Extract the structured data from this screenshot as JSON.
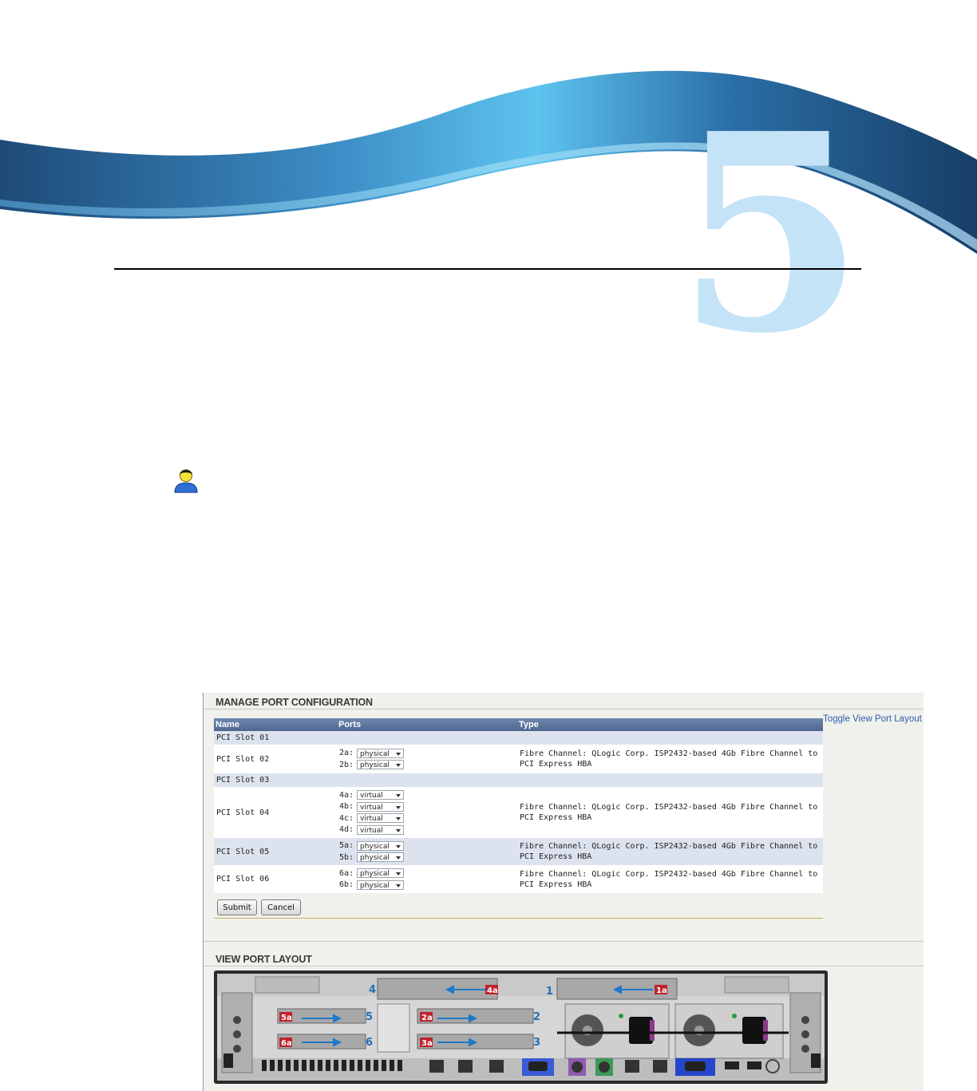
{
  "chapter_number": "5",
  "manage_section": {
    "title": "MANAGE PORT CONFIGURATION",
    "toggle_link": "Toggle View Port Layout",
    "columns": [
      "Name",
      "Ports",
      "Type"
    ],
    "rows": [
      {
        "name": "PCI Slot 01",
        "ports": [],
        "type": ""
      },
      {
        "name": "PCI Slot 02",
        "ports": [
          {
            "label": "2a:",
            "value": "physical"
          },
          {
            "label": "2b:",
            "value": "physical"
          }
        ],
        "type": "Fibre Channel: QLogic Corp. ISP2432-based 4Gb Fibre Channel to PCI Express HBA"
      },
      {
        "name": "PCI Slot 03",
        "ports": [],
        "type": ""
      },
      {
        "name": "PCI Slot 04",
        "ports": [
          {
            "label": "4a:",
            "value": "virtual"
          },
          {
            "label": "4b:",
            "value": "virtual"
          },
          {
            "label": "4c:",
            "value": "virtual"
          },
          {
            "label": "4d:",
            "value": "virtual"
          }
        ],
        "type": "Fibre Channel: QLogic Corp. ISP2432-based 4Gb Fibre Channel to PCI Express HBA"
      },
      {
        "name": "PCI Slot 05",
        "ports": [
          {
            "label": "5a:",
            "value": "physical"
          },
          {
            "label": "5b:",
            "value": "physical"
          }
        ],
        "type": "Fibre Channel: QLogic Corp. ISP2432-based 4Gb Fibre Channel to PCI Express HBA"
      },
      {
        "name": "PCI Slot 06",
        "ports": [
          {
            "label": "6a:",
            "value": "physical"
          },
          {
            "label": "6b:",
            "value": "physical"
          }
        ],
        "type": "Fibre Channel: QLogic Corp. ISP2432-based 4Gb Fibre Channel to PCI Express HBA"
      }
    ],
    "submit_label": "Submit",
    "cancel_label": "Cancel"
  },
  "layout_section": {
    "title": "VIEW PORT LAYOUT",
    "slot_numbers": [
      "1",
      "2",
      "3",
      "4",
      "5",
      "6"
    ],
    "port_labels": [
      "1a",
      "2a",
      "3a",
      "4a",
      "5a",
      "6a"
    ]
  },
  "colors": {
    "banner_dark": "#1d4a79",
    "banner_light": "#4fb8e8",
    "chapter_digit": "#c4e3f7",
    "table_header": "#58709a",
    "row_alt": "#dce3ee",
    "link": "#2d5fb0",
    "port_label_red": "#c0202c",
    "slot_number_blue": "#1f6fb8"
  }
}
